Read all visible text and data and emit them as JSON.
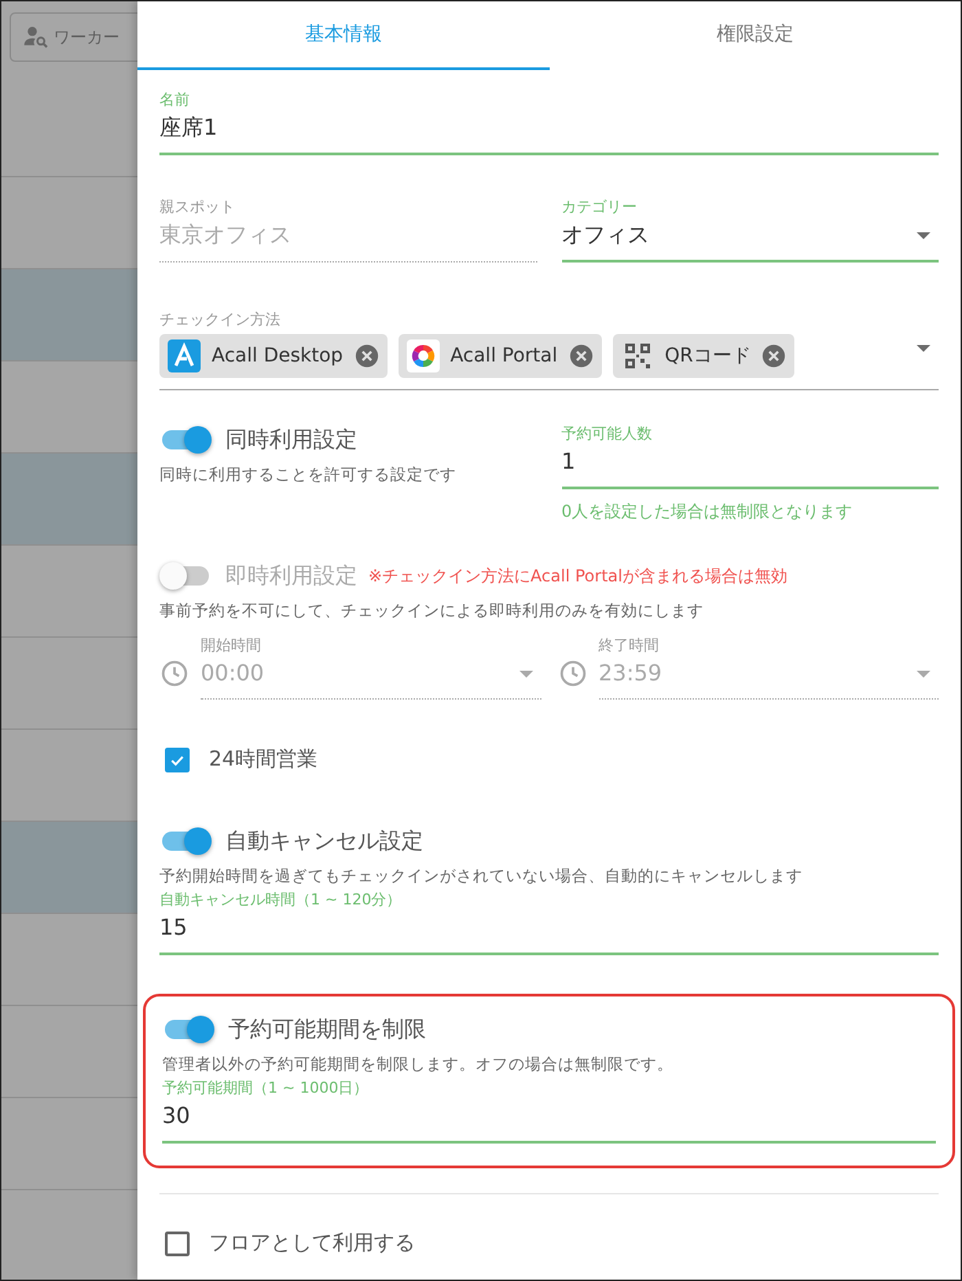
{
  "background": {
    "search": {
      "placeholder": "ワーカー"
    },
    "rows": [
      {
        "selected": false
      },
      {
        "selected": true
      },
      {
        "selected": false
      },
      {
        "selected": true
      },
      {
        "selected": false
      },
      {
        "selected": false
      },
      {
        "selected": false
      },
      {
        "selected": true
      },
      {
        "selected": false
      },
      {
        "selected": false
      },
      {
        "selected": false
      },
      {
        "selected": false
      }
    ]
  },
  "tabs": [
    {
      "label": "基本情報",
      "selected": true
    },
    {
      "label": "権限設定",
      "selected": false
    }
  ],
  "name_field": {
    "label": "名前",
    "value": "座席1"
  },
  "parent_spot": {
    "label": "親スポット",
    "value": "東京オフィス",
    "disabled": true
  },
  "category": {
    "label": "カテゴリー",
    "value": "オフィス"
  },
  "checkin_methods": {
    "label": "チェックイン方法",
    "chips": [
      {
        "kind": "desktop",
        "label": "Acall Desktop"
      },
      {
        "kind": "portal",
        "label": "Acall Portal"
      },
      {
        "kind": "qr",
        "label": "QRコード"
      }
    ]
  },
  "simultaneous": {
    "label": "同時利用設定",
    "on": true,
    "description": "同時に利用することを許可する設定です",
    "capacity": {
      "label": "予約可能人数",
      "value": "1",
      "hint": "0人を設定した場合は無制限となります"
    }
  },
  "instant": {
    "label": "即時利用設定",
    "on": false,
    "warning": "※チェックイン方法にAcall Portalが含まれる場合は無効",
    "description": "事前予約を不可にして、チェックインによる即時利用のみを有効にします",
    "start": {
      "label": "開始時間",
      "value": "00:00"
    },
    "end": {
      "label": "終了時間",
      "value": "23:59"
    }
  },
  "all_day": {
    "label": "24時間営業",
    "checked": true
  },
  "auto_cancel": {
    "label": "自動キャンセル設定",
    "on": true,
    "description": "予約開始時間を過ぎてもチェックインがされていない場合、自動的にキャンセルします",
    "field": {
      "label": "自動キャンセル時間（1 ~ 120分）",
      "value": "15"
    }
  },
  "booking_period": {
    "label": "予約可能期間を制限",
    "on": true,
    "highlighted": true,
    "description": "管理者以外の予約可能期間を制限します。オフの場合は無制限です。",
    "field": {
      "label": "予約可能期間（1 ~ 1000日）",
      "value": "30"
    }
  },
  "use_as_floor": {
    "label": "フロアとして利用する",
    "checked": false
  }
}
